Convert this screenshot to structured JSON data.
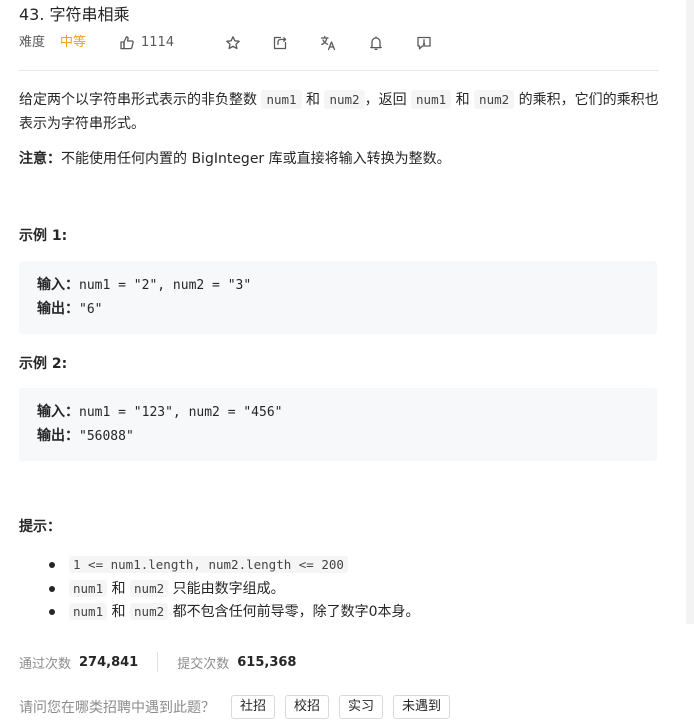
{
  "problem": {
    "title": "43. 字符串相乘",
    "difficulty_label": "难度",
    "difficulty_value": "中等",
    "likes": "1114"
  },
  "toolbar": {
    "icons": [
      "thumbs-up-icon",
      "star-icon",
      "share-icon",
      "translate-icon",
      "bell-icon",
      "feedback-icon"
    ]
  },
  "description": {
    "p1_a": "给定两个以字符串形式表示的非负整数 ",
    "code_num1": "num1",
    "p1_and": " 和 ",
    "code_num2": "num2",
    "p1_b": "，返回 ",
    "p1_and2": " 和 ",
    "p1_c": " 的乘积，它们的乘积也表示为字符串形式。",
    "note_label": "注意：",
    "note_text": "不能使用任何内置的 BigInteger 库或直接将输入转换为整数。"
  },
  "examples": [
    {
      "title": "示例 1:",
      "input_label": "输入：",
      "input_value": "num1 = \"2\", num2 = \"3\"",
      "output_label": "输出：",
      "output_value": "\"6\""
    },
    {
      "title": "示例 2:",
      "input_label": "输入：",
      "input_value": "num1 = \"123\", num2 = \"456\"",
      "output_label": "输出：",
      "output_value": "\"56088\""
    }
  ],
  "hints": {
    "title": "提示：",
    "item1_code": "1 <= num1.length, num2.length <= 200",
    "item2_code_a": "num1",
    "item2_and": " 和 ",
    "item2_code_b": "num2",
    "item2_text": " 只能由数字组成。",
    "item3_code_a": "num1",
    "item3_and": " 和 ",
    "item3_code_b": "num2",
    "item3_text": " 都不包含任何前导零，除了数字0本身。"
  },
  "stats": {
    "accepted_label": "通过次数",
    "accepted_value": "274,841",
    "submitted_label": "提交次数",
    "submitted_value": "615,368"
  },
  "where_seen": {
    "label": "请问您在哪类招聘中遇到此题？",
    "options": [
      "社招",
      "校招",
      "实习",
      "未遇到"
    ]
  }
}
